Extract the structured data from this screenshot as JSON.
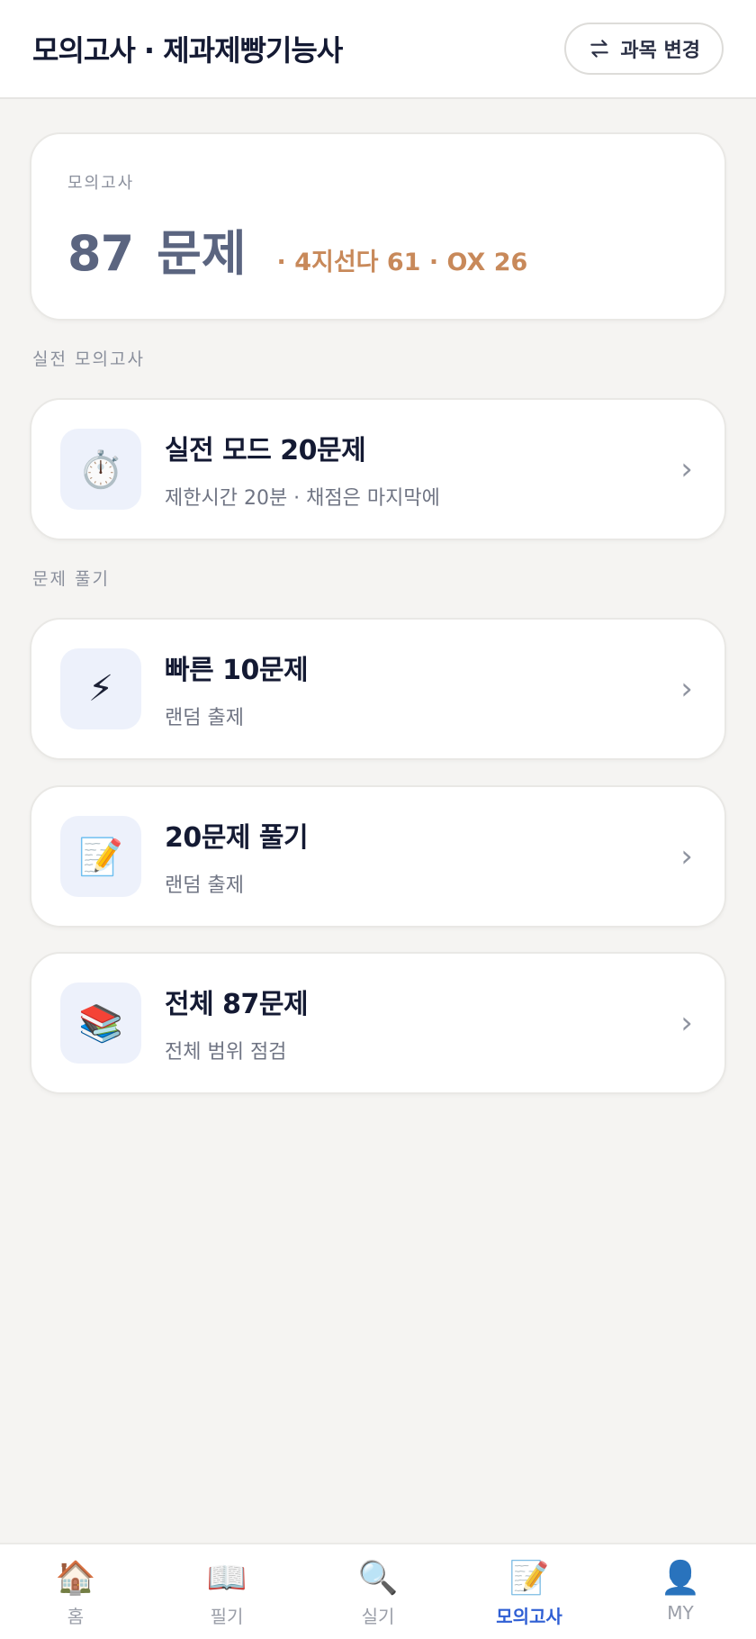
{
  "header": {
    "title": "모의고사 · 제과제빵기능사",
    "change_button": "과목 변경"
  },
  "summary": {
    "label": "모의고사",
    "count": "87",
    "unit": "문제",
    "breakdown": "· 4지선다 61 · OX 26"
  },
  "sections": {
    "practical": "실전 모의고사",
    "practice": "문제 풀기"
  },
  "items": [
    {
      "icon": "stopwatch-icon",
      "glyph": "⏱️",
      "title": "실전 모드 20문제",
      "subtitle": "제한시간 20분 · 채점은 마지막에"
    },
    {
      "icon": "lightning-icon",
      "glyph": "⚡",
      "title": "빠른 10문제",
      "subtitle": "랜덤 출제"
    },
    {
      "icon": "memo-icon",
      "glyph": "📝",
      "title": "20문제 풀기",
      "subtitle": "랜덤 출제"
    },
    {
      "icon": "books-icon",
      "glyph": "📚",
      "title": "전체 87문제",
      "subtitle": "전체 범위 점검"
    }
  ],
  "tabs": [
    {
      "label": "홈",
      "icon": "house-icon",
      "glyph": "🏠",
      "active": false
    },
    {
      "label": "필기",
      "icon": "book-icon",
      "glyph": "📖",
      "active": false
    },
    {
      "label": "실기",
      "icon": "magnifier-icon",
      "glyph": "🔍",
      "active": false
    },
    {
      "label": "모의고사",
      "icon": "memo-icon",
      "glyph": "📝",
      "active": true
    },
    {
      "label": "MY",
      "icon": "user-icon",
      "glyph": "👤",
      "active": false
    }
  ],
  "colors": {
    "accent": "#2f5fd4",
    "breakdown": "#c8895a",
    "count": "#5b6580",
    "background": "#f5f4f2"
  }
}
